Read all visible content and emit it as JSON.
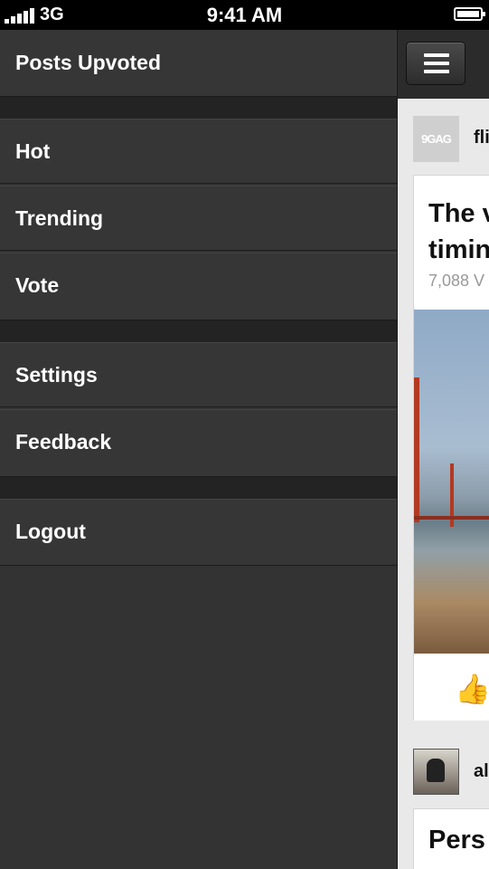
{
  "status_bar": {
    "carrier": "3G",
    "time": "9:41 AM"
  },
  "menu": {
    "header": "Posts Upvoted",
    "section1": [
      "Hot",
      "Trending",
      "Vote"
    ],
    "section2": [
      "Settings",
      "Feedback"
    ],
    "section3": [
      "Logout"
    ]
  },
  "feed": {
    "post1": {
      "avatar_text": "9GAG",
      "poster": "fli",
      "title_line1": "The v",
      "title_line2": "timin",
      "votes": "7,088 V",
      "like_icon": "thumbs-up-icon"
    },
    "post2": {
      "poster": "al",
      "title": "Pers"
    }
  }
}
